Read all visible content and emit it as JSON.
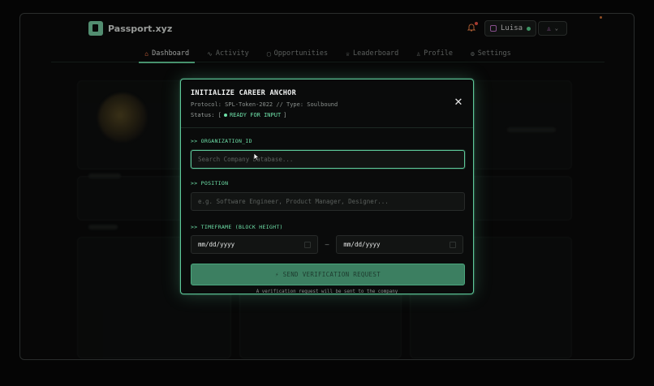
{
  "brand": {
    "name": "Passport.xyz"
  },
  "header": {
    "bell_icon": "bell-icon",
    "user": {
      "name": "Luisa",
      "status_color": "#5fe39a"
    },
    "wallet_icon": "user-square-icon"
  },
  "nav": {
    "items": [
      {
        "label": "Dashboard",
        "icon": "home-icon",
        "glyph": "⌂",
        "active": true
      },
      {
        "label": "Activity",
        "icon": "activity-icon",
        "glyph": "∿",
        "active": false
      },
      {
        "label": "Opportunities",
        "icon": "briefcase-icon",
        "glyph": "▢",
        "active": false
      },
      {
        "label": "Leaderboard",
        "icon": "trophy-icon",
        "glyph": "♕",
        "active": false
      },
      {
        "label": "Profile",
        "icon": "person-icon",
        "glyph": "♙",
        "active": false
      },
      {
        "label": "Settings",
        "icon": "gear-icon",
        "glyph": "⚙",
        "active": false
      }
    ]
  },
  "modal": {
    "title": "INITIALIZE CAREER ANCHOR",
    "protocol": "Protocol: SPL-Token-2022 // Type: Soulbound",
    "status_prefix": "Status: [",
    "status_value": "READY FOR INPUT",
    "status_suffix": "]",
    "close_glyph": "✕",
    "org_label": ">> ORGANIZATION_ID",
    "org_placeholder": "Search Company Database...",
    "org_value": "",
    "position_label": ">> POSITION",
    "position_placeholder": "e.g. Software Engineer, Product Manager, Designer...",
    "position_value": "",
    "timeframe_label": ">> TIMEFRAME (BLOCK HEIGHT)",
    "start_date": "mm/dd/yyyy",
    "end_date": "mm/dd/yyyy",
    "date_separator": "—",
    "submit_label": "⚡ SEND VERIFICATION REQUEST",
    "note": "A verification request will be sent to the company"
  },
  "colors": {
    "accent": "#6ee0a8",
    "modal_border": "#5ec99a",
    "submit_bg": "#3c7f61",
    "active_nav_icon": "#ff7a4a",
    "notification_dot": "#ff5a4a"
  }
}
